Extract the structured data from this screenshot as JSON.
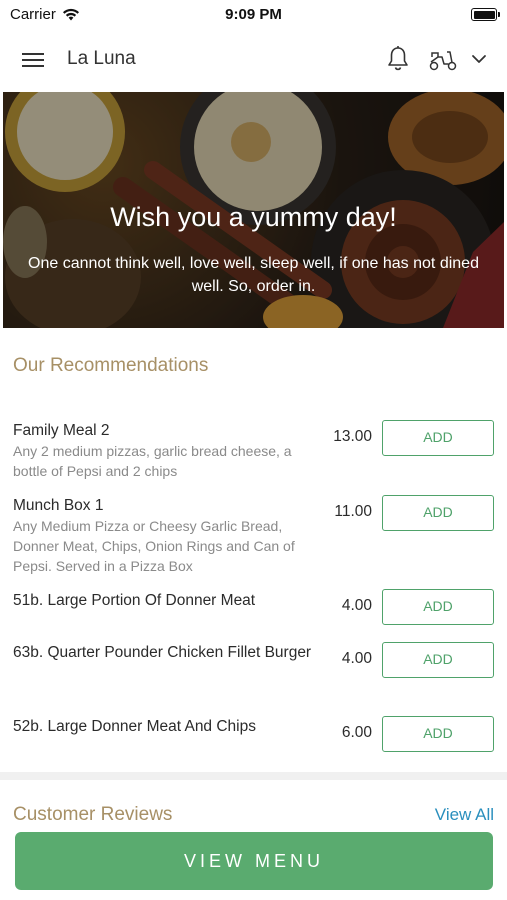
{
  "status_bar": {
    "carrier": "Carrier",
    "time": "9:09 PM"
  },
  "header": {
    "title": "La Luna"
  },
  "hero": {
    "title": "Wish you a yummy day!",
    "subtitle": "One cannot think well, love well, sleep well, if one has not dined well. So, order in."
  },
  "recommendations": {
    "title": "Our Recommendations",
    "add_label": "ADD",
    "items": [
      {
        "name": "Family Meal 2",
        "description": "Any 2 medium pizzas, garlic bread cheese, a bottle of Pepsi and 2 chips",
        "price": "13.00"
      },
      {
        "name": "Munch Box 1",
        "description": "Any Medium Pizza or Cheesy Garlic Bread, Donner Meat, Chips, Onion Rings and Can of Pepsi. Served in a Pizza Box",
        "price": "11.00"
      },
      {
        "name": "51b. Large Portion Of Donner Meat",
        "description": "",
        "price": "4.00"
      },
      {
        "name": "63b. Quarter Pounder Chicken Fillet Burger",
        "description": "",
        "price": "4.00"
      },
      {
        "name": "52b. Large Donner Meat And Chips",
        "description": "",
        "price": "6.00"
      }
    ]
  },
  "reviews": {
    "title": "Customer Reviews",
    "view_all": "View All"
  },
  "view_menu": {
    "label": "VIEW MENU"
  },
  "colors": {
    "accent_green": "#5aab6f",
    "section_title": "#a79066",
    "link_blue": "#2a8fbd"
  },
  "icons": [
    "menu-icon",
    "bell-icon",
    "scooter-icon",
    "chevron-down-icon",
    "wifi-icon",
    "battery-icon"
  ]
}
